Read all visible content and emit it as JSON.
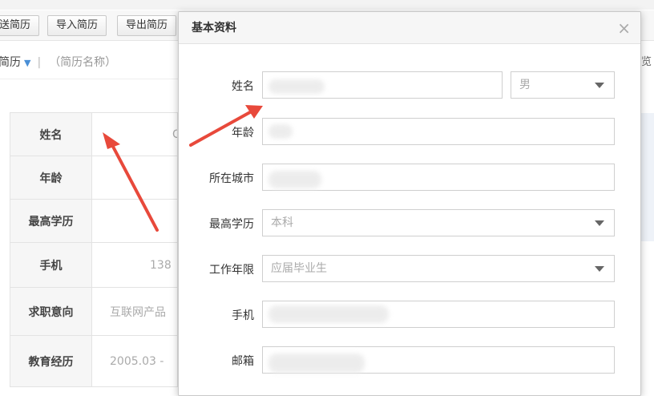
{
  "toolbar": {
    "buttons": [
      "送简历",
      "导入简历",
      "导出简历"
    ]
  },
  "breadcrumb": {
    "current": "简历",
    "resume_name": "（简历名称）"
  },
  "profile_table": {
    "rows": [
      {
        "label": "姓名",
        "value": "C"
      },
      {
        "label": "年龄",
        "value": ""
      },
      {
        "label": "最高学历",
        "value": ""
      },
      {
        "label": "手机",
        "value": "138"
      },
      {
        "label": "求职意向",
        "value": "互联网产品"
      },
      {
        "label": "教育经历",
        "value": "2005.03 -"
      }
    ]
  },
  "right_edge_text": "览",
  "modal": {
    "title": "基本资料",
    "close_symbol": "×",
    "fields": {
      "name": {
        "label": "姓名",
        "value": ""
      },
      "gender": {
        "value": "男"
      },
      "age": {
        "label": "年龄",
        "value": ""
      },
      "city": {
        "label": "所在城市",
        "value": ""
      },
      "education": {
        "label": "最高学历",
        "value": "本科"
      },
      "experience": {
        "label": "工作年限",
        "value": "应届毕业生"
      },
      "phone": {
        "label": "手机",
        "value": ""
      },
      "email": {
        "label": "邮箱",
        "value": ""
      }
    }
  },
  "colors": {
    "arrow": "#e8493b",
    "link_blue": "#4a8fd6"
  },
  "icons": [
    "dropdown-caret-icon",
    "close-icon",
    "red-arrow-annotation"
  ]
}
